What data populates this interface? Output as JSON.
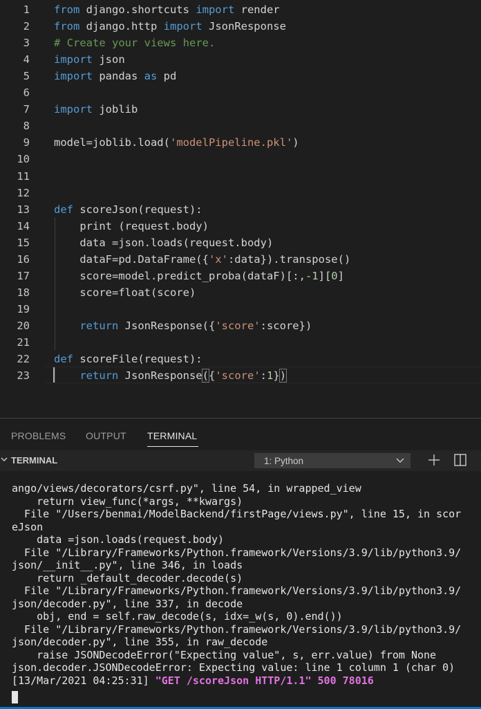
{
  "editor": {
    "lines": [
      {
        "n": "1",
        "tokens": [
          {
            "t": "kw",
            "v": "from"
          },
          {
            "t": "plain",
            "v": " django.shortcuts "
          },
          {
            "t": "kw",
            "v": "import"
          },
          {
            "t": "plain",
            "v": " render"
          }
        ]
      },
      {
        "n": "2",
        "tokens": [
          {
            "t": "kw",
            "v": "from"
          },
          {
            "t": "plain",
            "v": " django.http "
          },
          {
            "t": "kw",
            "v": "import"
          },
          {
            "t": "plain",
            "v": " JsonResponse"
          }
        ]
      },
      {
        "n": "3",
        "tokens": [
          {
            "t": "com",
            "v": "# Create your views here."
          }
        ]
      },
      {
        "n": "4",
        "tokens": [
          {
            "t": "kw",
            "v": "import"
          },
          {
            "t": "plain",
            "v": " json"
          }
        ]
      },
      {
        "n": "5",
        "tokens": [
          {
            "t": "kw",
            "v": "import"
          },
          {
            "t": "plain",
            "v": " pandas "
          },
          {
            "t": "kw",
            "v": "as"
          },
          {
            "t": "plain",
            "v": " pd"
          }
        ]
      },
      {
        "n": "6",
        "tokens": []
      },
      {
        "n": "7",
        "tokens": [
          {
            "t": "kw",
            "v": "import"
          },
          {
            "t": "plain",
            "v": " joblib"
          }
        ]
      },
      {
        "n": "8",
        "tokens": []
      },
      {
        "n": "9",
        "tokens": [
          {
            "t": "plain",
            "v": "model=joblib.load("
          },
          {
            "t": "str",
            "v": "'modelPipeline.pkl'"
          },
          {
            "t": "plain",
            "v": ")"
          }
        ]
      },
      {
        "n": "10",
        "tokens": []
      },
      {
        "n": "11",
        "tokens": []
      },
      {
        "n": "12",
        "tokens": []
      },
      {
        "n": "13",
        "tokens": [
          {
            "t": "kw",
            "v": "def"
          },
          {
            "t": "plain",
            "v": " scoreJson(request):"
          }
        ]
      },
      {
        "n": "14",
        "tokens": [
          {
            "t": "plain",
            "v": "    print (request.body)"
          }
        ]
      },
      {
        "n": "15",
        "tokens": [
          {
            "t": "plain",
            "v": "    data =json.loads(request.body)"
          }
        ]
      },
      {
        "n": "16",
        "tokens": [
          {
            "t": "plain",
            "v": "    dataF=pd.DataFrame({"
          },
          {
            "t": "str",
            "v": "'x'"
          },
          {
            "t": "plain",
            "v": ":data}).transpose()"
          }
        ]
      },
      {
        "n": "17",
        "tokens": [
          {
            "t": "plain",
            "v": "    score=model.predict_proba(dataF)[:,"
          },
          {
            "t": "num",
            "v": "-1"
          },
          {
            "t": "plain",
            "v": "]["
          },
          {
            "t": "num",
            "v": "0"
          },
          {
            "t": "plain",
            "v": "]"
          }
        ]
      },
      {
        "n": "18",
        "tokens": [
          {
            "t": "plain",
            "v": "    score=float(score)"
          }
        ]
      },
      {
        "n": "19",
        "tokens": []
      },
      {
        "n": "20",
        "tokens": [
          {
            "t": "plain",
            "v": "    "
          },
          {
            "t": "kw",
            "v": "return"
          },
          {
            "t": "plain",
            "v": " JsonResponse({"
          },
          {
            "t": "str",
            "v": "'score'"
          },
          {
            "t": "plain",
            "v": ":score})"
          }
        ]
      },
      {
        "n": "21",
        "tokens": []
      },
      {
        "n": "22",
        "tokens": [
          {
            "t": "kw",
            "v": "def"
          },
          {
            "t": "plain",
            "v": " scoreFile(request):"
          }
        ]
      },
      {
        "n": "23",
        "tokens": [
          {
            "t": "plain",
            "v": "    "
          },
          {
            "t": "kw",
            "v": "return"
          },
          {
            "t": "plain",
            "v": " JsonResponse"
          },
          {
            "t": "plainhl",
            "v": "("
          },
          {
            "t": "plain",
            "v": "{"
          },
          {
            "t": "str",
            "v": "'score'"
          },
          {
            "t": "plain",
            "v": ":"
          },
          {
            "t": "num",
            "v": "1"
          },
          {
            "t": "plain",
            "v": "}"
          },
          {
            "t": "plainhl",
            "v": ")"
          }
        ]
      }
    ]
  },
  "panel": {
    "tabs": [
      "PROBLEMS",
      "OUTPUT",
      "TERMINAL"
    ],
    "active_tab": "TERMINAL",
    "section_title": "TERMINAL",
    "terminal_select": "1: Python",
    "output_lines": [
      "ango/views/decorators/csrf.py\", line 54, in wrapped_view",
      "    return view_func(*args, **kwargs)",
      "  File \"/Users/benmai/ModelBackend/firstPage/views.py\", line 15, in scor",
      "eJson",
      "    data =json.loads(request.body)",
      "  File \"/Library/Frameworks/Python.framework/Versions/3.9/lib/python3.9/",
      "json/__init__.py\", line 346, in loads",
      "    return _default_decoder.decode(s)",
      "  File \"/Library/Frameworks/Python.framework/Versions/3.9/lib/python3.9/",
      "json/decoder.py\", line 337, in decode",
      "    obj, end = self.raw_decode(s, idx=_w(s, 0).end())",
      "  File \"/Library/Frameworks/Python.framework/Versions/3.9/lib/python3.9/",
      "json/decoder.py\", line 355, in raw_decode",
      "    raise JSONDecodeError(\"Expecting value\", s, err.value) from None",
      "json.decoder.JSONDecodeError: Expecting value: line 1 column 1 (char 0)"
    ],
    "access_log": {
      "timestamp": "[13/Mar/2021 04:25:31]",
      "request": "\"GET /scoreJson HTTP/1.1\" 500 78016"
    }
  }
}
